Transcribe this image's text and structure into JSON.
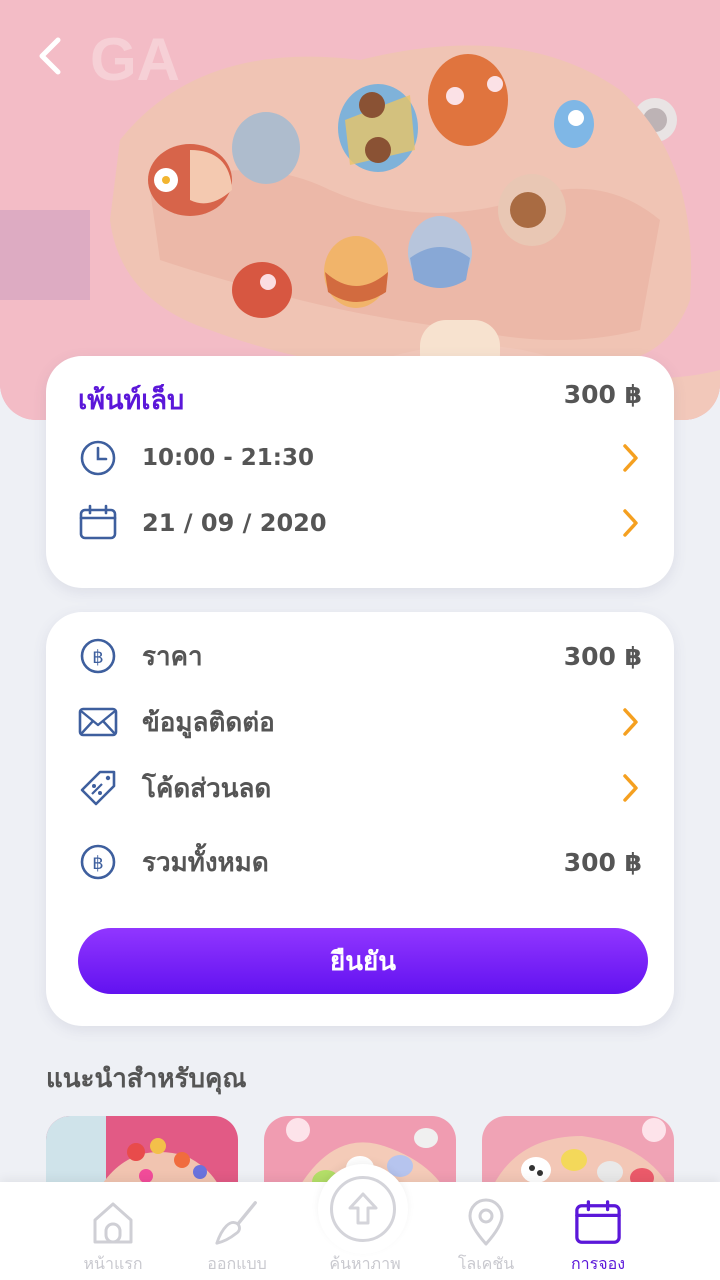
{
  "service": {
    "name": "เพ้นท์เล็บ",
    "price": "300 ฿",
    "time": "10:00 - 21:30",
    "date": "21 / 09 / 2020"
  },
  "summary": {
    "price_label": "ราคา",
    "price_value": "300 ฿",
    "contact_label": "ข้อมูลติดต่อ",
    "discount_label": "โค้ดส่วนลด",
    "total_label": "รวมทั้งหมด",
    "total_value": "300 ฿",
    "confirm_label": "ยืนยัน"
  },
  "recommendations": {
    "title": "แนะนำสำหรับคุณ"
  },
  "nav": {
    "items": [
      {
        "label": "หน้าแรก",
        "icon": "home-icon"
      },
      {
        "label": "ออกแบบ",
        "icon": "brush-icon"
      },
      {
        "label": "ค้นหาภาพ",
        "icon": "upload-icon"
      },
      {
        "label": "โลเคชัน",
        "icon": "location-pin-icon"
      },
      {
        "label": "การจอง",
        "icon": "calendar-icon",
        "active": true
      }
    ]
  },
  "colors": {
    "accent": "#5b17d9",
    "button_gradient_top": "#9136ff",
    "button_gradient_bottom": "#6212f0",
    "chevron": "#f5a020",
    "icon_blue": "#3e5f9e",
    "background": "#eef0f5"
  }
}
